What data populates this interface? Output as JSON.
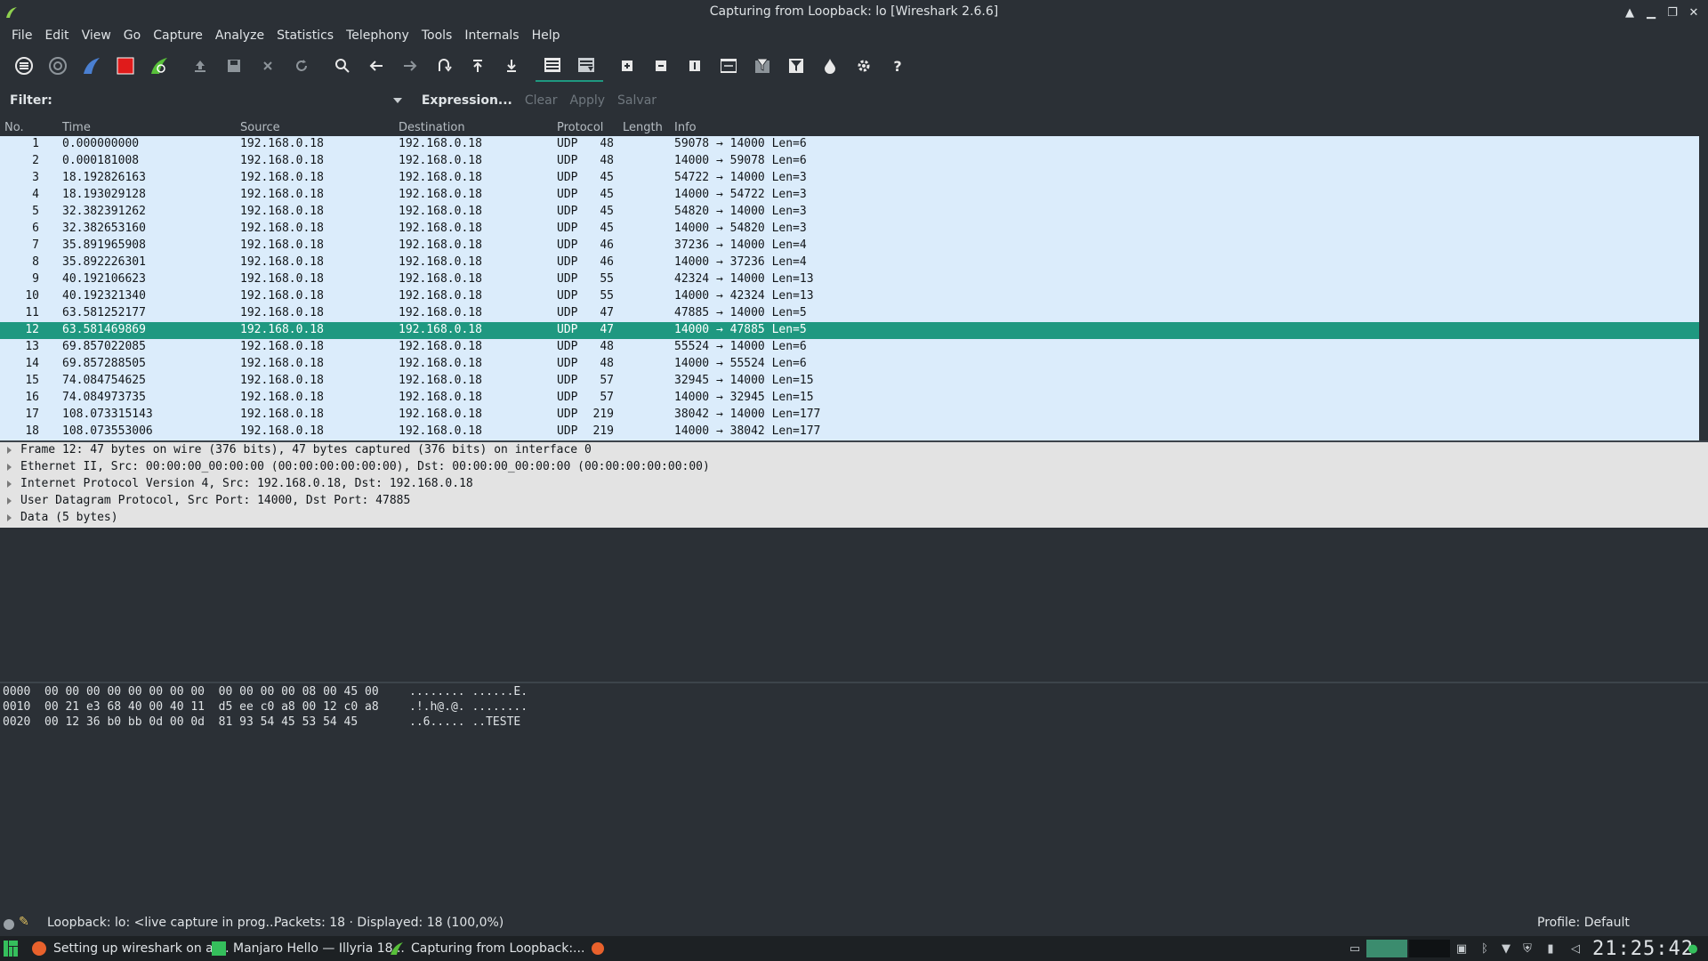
{
  "window": {
    "title": "Capturing from Loopback: lo [Wireshark 2.6.6]"
  },
  "menu": [
    "File",
    "Edit",
    "View",
    "Go",
    "Capture",
    "Analyze",
    "Statistics",
    "Telephony",
    "Tools",
    "Internals",
    "Help"
  ],
  "toolbar": {
    "icons": [
      "interface-list-icon",
      "capture-options-icon",
      "start-capture-icon",
      "stop-capture-icon",
      "restart-capture-icon",
      "open-file-icon",
      "save-file-icon",
      "close-file-icon",
      "reload-icon",
      "find-packet-icon",
      "go-back-icon",
      "go-forward-icon",
      "go-to-packet-icon",
      "go-first-packet-icon",
      "go-last-packet-icon",
      "colorize-icon",
      "auto-scroll-icon",
      "zoom-in-icon",
      "zoom-out-icon",
      "normal-size-icon",
      "resize-columns-icon",
      "capture-filters-icon",
      "display-filters-icon",
      "coloring-rules-icon",
      "preferences-icon",
      "help-icon"
    ]
  },
  "filter": {
    "label": "Filter:",
    "value": "",
    "expression_label": "Expression...",
    "clear_label": "Clear",
    "apply_label": "Apply",
    "save_label": "Salvar"
  },
  "packet_list": {
    "columns": [
      "No.",
      "Time",
      "Source",
      "Destination",
      "Protocol",
      "Length",
      "Info"
    ],
    "selected_index": 11,
    "rows": [
      {
        "no": "1",
        "time": "0.000000000",
        "source": "192.168.0.18",
        "destination": "192.168.0.18",
        "protocol": "UDP",
        "length": "48",
        "info": "59078 → 14000 Len=6"
      },
      {
        "no": "2",
        "time": "0.000181008",
        "source": "192.168.0.18",
        "destination": "192.168.0.18",
        "protocol": "UDP",
        "length": "48",
        "info": "14000 → 59078 Len=6"
      },
      {
        "no": "3",
        "time": "18.192826163",
        "source": "192.168.0.18",
        "destination": "192.168.0.18",
        "protocol": "UDP",
        "length": "45",
        "info": "54722 → 14000 Len=3"
      },
      {
        "no": "4",
        "time": "18.193029128",
        "source": "192.168.0.18",
        "destination": "192.168.0.18",
        "protocol": "UDP",
        "length": "45",
        "info": "14000 → 54722 Len=3"
      },
      {
        "no": "5",
        "time": "32.382391262",
        "source": "192.168.0.18",
        "destination": "192.168.0.18",
        "protocol": "UDP",
        "length": "45",
        "info": "54820 → 14000 Len=3"
      },
      {
        "no": "6",
        "time": "32.382653160",
        "source": "192.168.0.18",
        "destination": "192.168.0.18",
        "protocol": "UDP",
        "length": "45",
        "info": "14000 → 54820 Len=3"
      },
      {
        "no": "7",
        "time": "35.891965908",
        "source": "192.168.0.18",
        "destination": "192.168.0.18",
        "protocol": "UDP",
        "length": "46",
        "info": "37236 → 14000 Len=4"
      },
      {
        "no": "8",
        "time": "35.892226301",
        "source": "192.168.0.18",
        "destination": "192.168.0.18",
        "protocol": "UDP",
        "length": "46",
        "info": "14000 → 37236 Len=4"
      },
      {
        "no": "9",
        "time": "40.192106623",
        "source": "192.168.0.18",
        "destination": "192.168.0.18",
        "protocol": "UDP",
        "length": "55",
        "info": "42324 → 14000 Len=13"
      },
      {
        "no": "10",
        "time": "40.192321340",
        "source": "192.168.0.18",
        "destination": "192.168.0.18",
        "protocol": "UDP",
        "length": "55",
        "info": "14000 → 42324 Len=13"
      },
      {
        "no": "11",
        "time": "63.581252177",
        "source": "192.168.0.18",
        "destination": "192.168.0.18",
        "protocol": "UDP",
        "length": "47",
        "info": "47885 → 14000 Len=5"
      },
      {
        "no": "12",
        "time": "63.581469869",
        "source": "192.168.0.18",
        "destination": "192.168.0.18",
        "protocol": "UDP",
        "length": "47",
        "info": "14000 → 47885 Len=5"
      },
      {
        "no": "13",
        "time": "69.857022085",
        "source": "192.168.0.18",
        "destination": "192.168.0.18",
        "protocol": "UDP",
        "length": "48",
        "info": "55524 → 14000 Len=6"
      },
      {
        "no": "14",
        "time": "69.857288505",
        "source": "192.168.0.18",
        "destination": "192.168.0.18",
        "protocol": "UDP",
        "length": "48",
        "info": "14000 → 55524 Len=6"
      },
      {
        "no": "15",
        "time": "74.084754625",
        "source": "192.168.0.18",
        "destination": "192.168.0.18",
        "protocol": "UDP",
        "length": "57",
        "info": "32945 → 14000 Len=15"
      },
      {
        "no": "16",
        "time": "74.084973735",
        "source": "192.168.0.18",
        "destination": "192.168.0.18",
        "protocol": "UDP",
        "length": "57",
        "info": "14000 → 32945 Len=15"
      },
      {
        "no": "17",
        "time": "108.073315143",
        "source": "192.168.0.18",
        "destination": "192.168.0.18",
        "protocol": "UDP",
        "length": "219",
        "info": "38042 → 14000 Len=177"
      },
      {
        "no": "18",
        "time": "108.073553006",
        "source": "192.168.0.18",
        "destination": "192.168.0.18",
        "protocol": "UDP",
        "length": "219",
        "info": "14000 → 38042 Len=177"
      }
    ]
  },
  "details": [
    "Frame 12: 47 bytes on wire (376 bits), 47 bytes captured (376 bits) on interface 0",
    "Ethernet II, Src: 00:00:00_00:00:00 (00:00:00:00:00:00), Dst: 00:00:00_00:00:00 (00:00:00:00:00:00)",
    "Internet Protocol Version 4, Src: 192.168.0.18, Dst: 192.168.0.18",
    "User Datagram Protocol, Src Port: 14000, Dst Port: 47885",
    "Data (5 bytes)"
  ],
  "bytes": [
    {
      "offset": "0000",
      "hex": "00 00 00 00 00 00 00 00  00 00 00 00 08 00 45 00",
      "ascii": "........ ......E."
    },
    {
      "offset": "0010",
      "hex": "00 21 e3 68 40 00 40 11  d5 ee c0 a8 00 12 c0 a8",
      "ascii": ".!.h@.@. ........"
    },
    {
      "offset": "0020",
      "hex": "00 12 36 b0 bb 0d 00 0d  81 93 54 45 53 54 45",
      "ascii": "..6..... ..TESTE"
    }
  ],
  "status": {
    "capture_text": "Loopback: lo: <live capture in prog...",
    "packets_text": "Packets: 18 · Displayed: 18 (100,0%)",
    "profile_text": "Profile: Default"
  },
  "taskbar": {
    "tasks": [
      {
        "label": "Setting up wireshark on a ...",
        "icon": "firefox-icon"
      },
      {
        "label": "Manjaro Hello — Illyria 18...",
        "icon": "manjaro-icon"
      },
      {
        "label": "Capturing from Loopback:...",
        "icon": "wireshark-icon"
      }
    ],
    "clock": "21:25:42"
  },
  "colors": {
    "selected_row": "#1f9880",
    "packet_bg": "#dbecfb",
    "details_bg": "#e3e3e3",
    "window_bg": "#2b3036"
  }
}
